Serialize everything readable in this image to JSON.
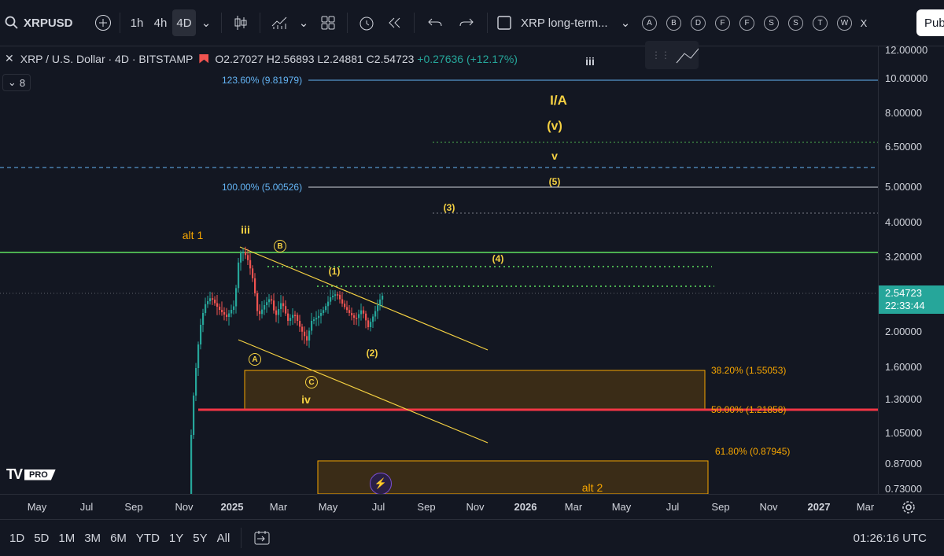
{
  "toolbar": {
    "symbol": "XRPUSD",
    "intervals": [
      "1h",
      "4h",
      "4D"
    ],
    "layout_name": "XRP long-term...",
    "letters": [
      "A",
      "B",
      "D",
      "F",
      "F",
      "S",
      "S",
      "T",
      "W",
      "X"
    ],
    "publish": "Pub"
  },
  "legend": {
    "title": "XRP / U.S. Dollar · 4D · BITSTAMP",
    "o": "O2.27027",
    "h": "H2.56893",
    "l": "L2.24881",
    "c": "C2.54723",
    "change": "+0.27636 (+12.17%)",
    "indicator_count": "8"
  },
  "price_axis": {
    "labels": [
      "12.00000",
      "10.00000",
      "8.00000",
      "6.50000",
      "5.00000",
      "4.00000",
      "3.20000",
      "2.00000",
      "1.60000",
      "1.30000",
      "1.05000",
      "0.87000",
      "0.73000"
    ],
    "current_price": "2.54723",
    "countdown": "22:33:44"
  },
  "time_axis": {
    "labels": [
      "May",
      "Jul",
      "Sep",
      "Nov",
      "2025",
      "Mar",
      "May",
      "Jul",
      "Sep",
      "Nov",
      "2026",
      "Mar",
      "May",
      "Jul",
      "Sep",
      "Nov",
      "2027",
      "Mar"
    ]
  },
  "fib": {
    "f1236": "123.60% (9.81979)",
    "f100": "100.00% (5.00526)",
    "f382": "38.20% (1.55053)",
    "f50": "50.00% (1.21858)",
    "f618": "61.80% (0.87945)"
  },
  "waves": {
    "iii_top": "iii",
    "IA": "I/A",
    "v_paren": "(v)",
    "v": "v",
    "w5": "(5)",
    "w3": "(3)",
    "alt1": "alt 1",
    "iii": "iii",
    "B": "B",
    "w4": "(4)",
    "w1": "(1)",
    "A": "A",
    "w2": "(2)",
    "C": "C",
    "iv": "iv",
    "alt2": "alt 2"
  },
  "bottom": {
    "ranges": [
      "1D",
      "5D",
      "1M",
      "3M",
      "6M",
      "YTD",
      "1Y",
      "5Y",
      "All"
    ],
    "clock": "01:26:16 UTC"
  },
  "brand": "PRO",
  "colors": {
    "bg": "#131722",
    "up": "#26a69a",
    "down": "#ef5350",
    "green_line": "#4caf50",
    "red_line": "#f23645",
    "fib": "#64b5f6",
    "wave": "#f5d142",
    "orange": "#f7a600"
  }
}
